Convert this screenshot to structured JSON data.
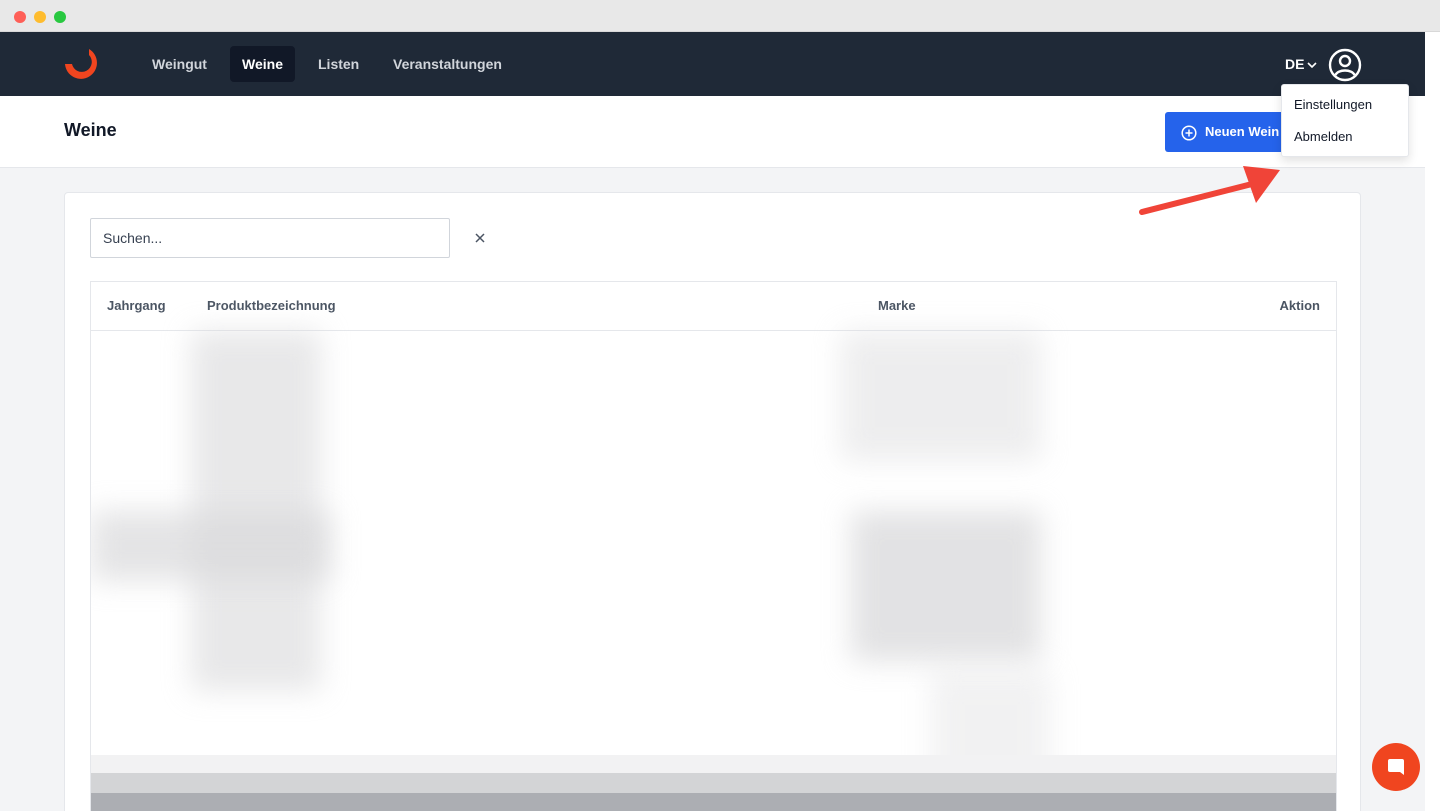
{
  "window": {
    "controls": [
      "close",
      "minimize",
      "maximize"
    ]
  },
  "nav": {
    "logo_icon": "crescent-logo-icon",
    "items": [
      {
        "label": "Weingut",
        "active": false
      },
      {
        "label": "Weine",
        "active": true
      },
      {
        "label": "Listen",
        "active": false
      },
      {
        "label": "Veranstaltungen",
        "active": false
      }
    ],
    "language": "DE",
    "avatar_icon": "user-circle-icon"
  },
  "header": {
    "title": "Weine",
    "new_button_label": "Neuen Wein"
  },
  "user_menu": {
    "items": [
      "Einstellungen",
      "Abmelden"
    ]
  },
  "search": {
    "placeholder": "Suchen...",
    "value": ""
  },
  "table": {
    "columns": [
      "Jahrgang",
      "Produktbezeichnung",
      "Marke",
      "Aktion"
    ],
    "rows_blurred": true
  },
  "colors": {
    "navbar": "#1f2937",
    "primary": "#2563eb",
    "brand": "#f0451f",
    "annotation_arrow": "#f04438"
  }
}
